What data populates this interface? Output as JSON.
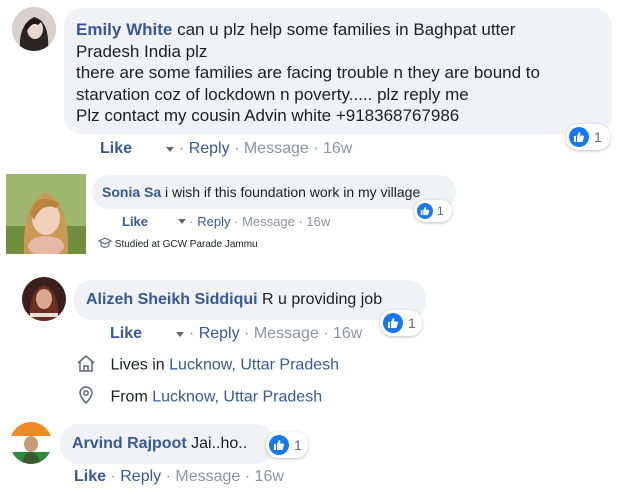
{
  "comments": [
    {
      "author": "Emily White",
      "text_lines": [
        "can u plz help some families in Baghpat utter",
        "Pradesh India plz",
        "there are some families are facing trouble n they are bound to",
        "starvation coz of lockdown n poverty..... plz reply me",
        "Plz contact my cousin Advin white +918368767986"
      ],
      "reaction_count": "1",
      "like_label": "Like",
      "reply_label": "Reply",
      "message_label": "Message",
      "time": "16w",
      "sep": "·"
    },
    {
      "author": "Sonia Sa",
      "text": "i wish if this foundation work in my village",
      "reaction_count": "1",
      "like_label": "Like",
      "reply_label": "Reply",
      "message_label": "Message",
      "time": "16w",
      "sep": "·",
      "info": "Studied at GCW Parade Jammu"
    },
    {
      "author": "Alizeh Sheikh Siddiqui",
      "text": "R u providing job",
      "reaction_count": "1",
      "like_label": "Like",
      "reply_label": "Reply",
      "message_label": "Message",
      "time": "16w",
      "sep": "·",
      "lives_prefix": "Lives in",
      "lives_place": "Lucknow, Uttar Pradesh",
      "from_prefix": "From",
      "from_place": "Lucknow, Uttar Pradesh"
    },
    {
      "author": "Arvind Rajpoot",
      "text": "Jai..ho..",
      "reaction_count": "1",
      "like_label": "Like",
      "reply_label": "Reply",
      "message_label": "Message",
      "time": "16w",
      "sep": "·"
    }
  ],
  "colors": {
    "link": "#385898",
    "bubble": "#f0f2f5",
    "like_blue": "#1877f2",
    "meta_gray": "#8d949e"
  }
}
